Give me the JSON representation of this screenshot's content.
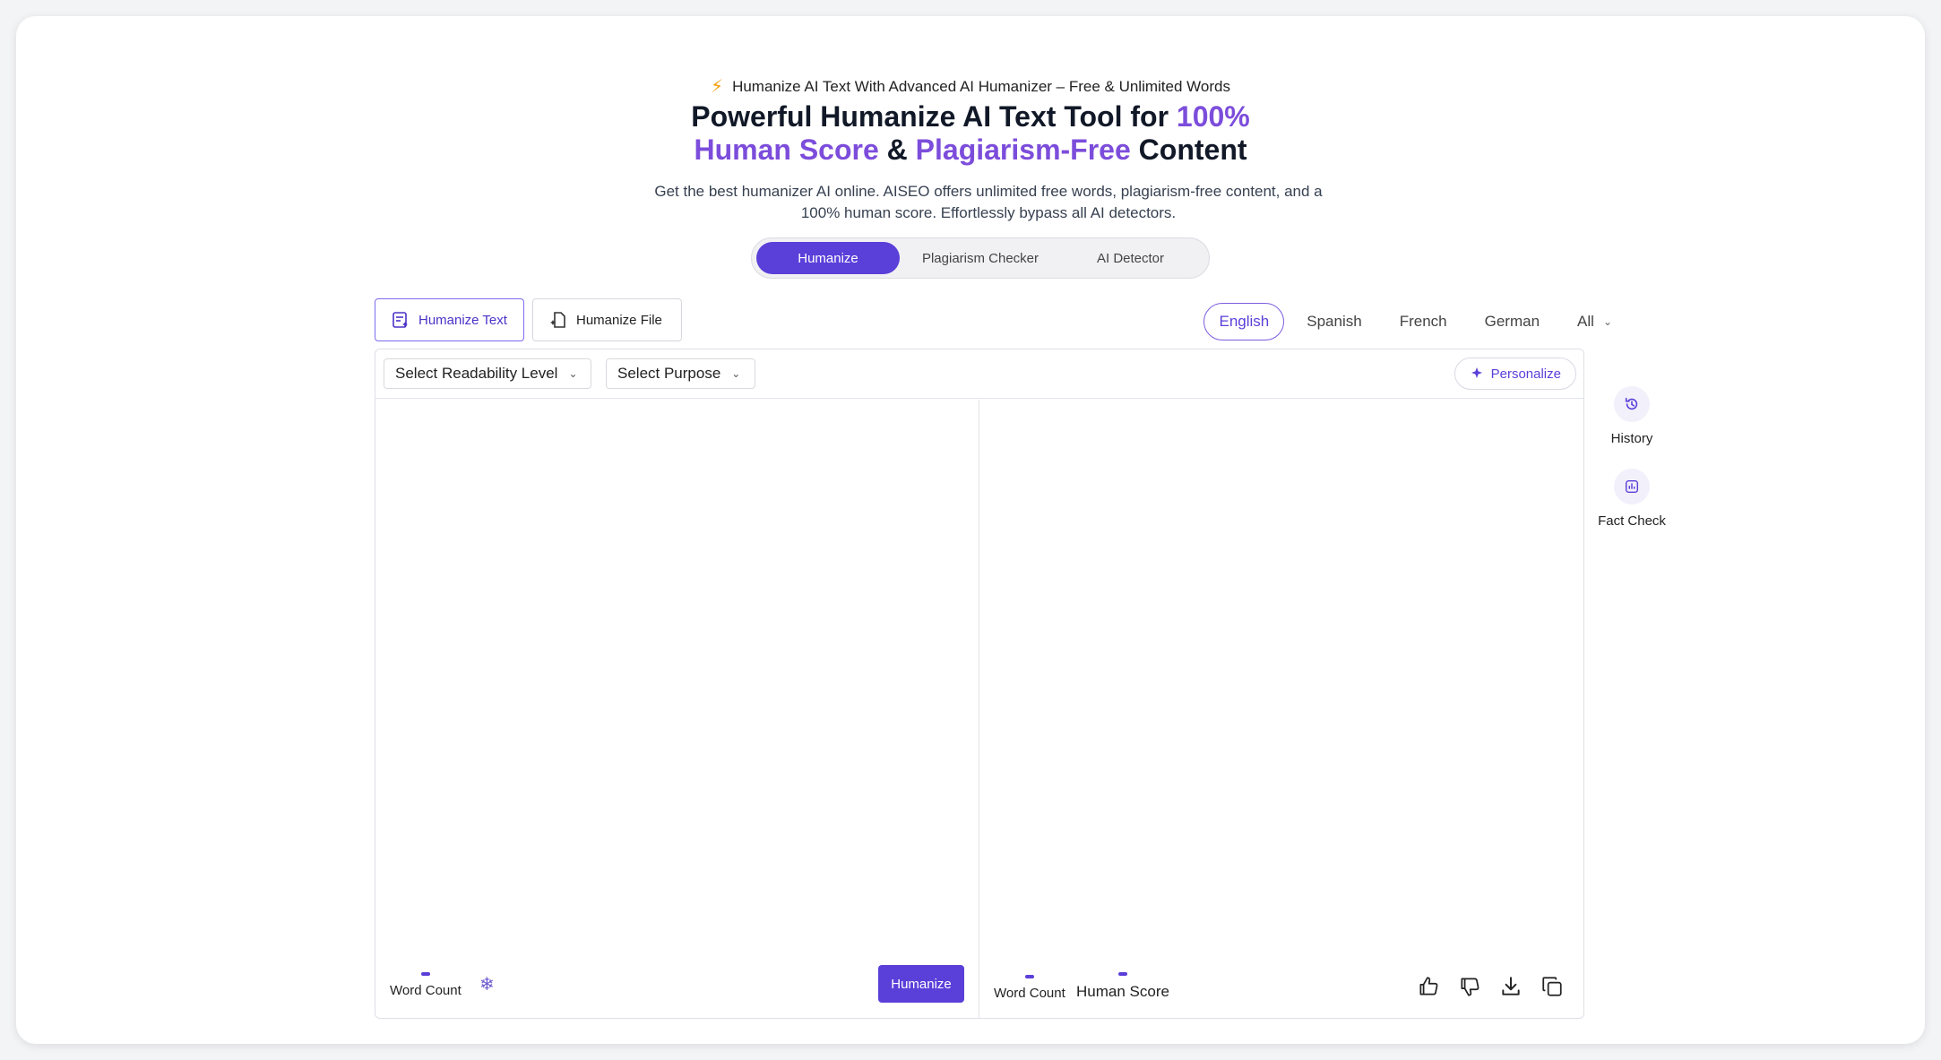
{
  "header": {
    "tagline": "Humanize AI Text With Advanced AI Humanizer – Free & Unlimited Words",
    "headline_part1": "Powerful Humanize AI Text Tool for ",
    "headline_part2": "100%",
    "headline_part3": "Human Score",
    "headline_part4": " & ",
    "headline_part5": "Plagiarism-Free",
    "headline_part6": " Content",
    "subtitle": "Get the best humanizer AI online. AISEO offers unlimited free words, plagiarism-free content, and a 100% human score. Effortlessly bypass all AI detectors."
  },
  "mode_tabs": [
    {
      "label": "Humanize",
      "active": true
    },
    {
      "label": "Plagiarism Checker",
      "active": false
    },
    {
      "label": "AI Detector",
      "active": false
    }
  ],
  "input_tabs": [
    {
      "label": "Humanize Text",
      "active": true
    },
    {
      "label": "Humanize File",
      "active": false
    }
  ],
  "languages": [
    {
      "label": "English",
      "active": true
    },
    {
      "label": "Spanish",
      "active": false
    },
    {
      "label": "French",
      "active": false
    },
    {
      "label": "German",
      "active": false
    },
    {
      "label": "All",
      "active": false
    }
  ],
  "toolbar": {
    "readability_label": "Select Readability Level",
    "purpose_label": "Select Purpose",
    "personalize_label": "Personalize"
  },
  "input_pane": {
    "text": "",
    "word_count_label": "Word Count",
    "humanize_button": "Humanize"
  },
  "output_pane": {
    "word_count_label": "Word Count",
    "human_score_label": "Human Score"
  },
  "side_tools": [
    {
      "label": "History",
      "icon": "history-icon"
    },
    {
      "label": "Fact Check",
      "icon": "chart-icon"
    }
  ],
  "colors": {
    "accent": "#5b3fd9",
    "headline_highlight": "#7c4ddb",
    "bolt": "#f59e0b"
  }
}
